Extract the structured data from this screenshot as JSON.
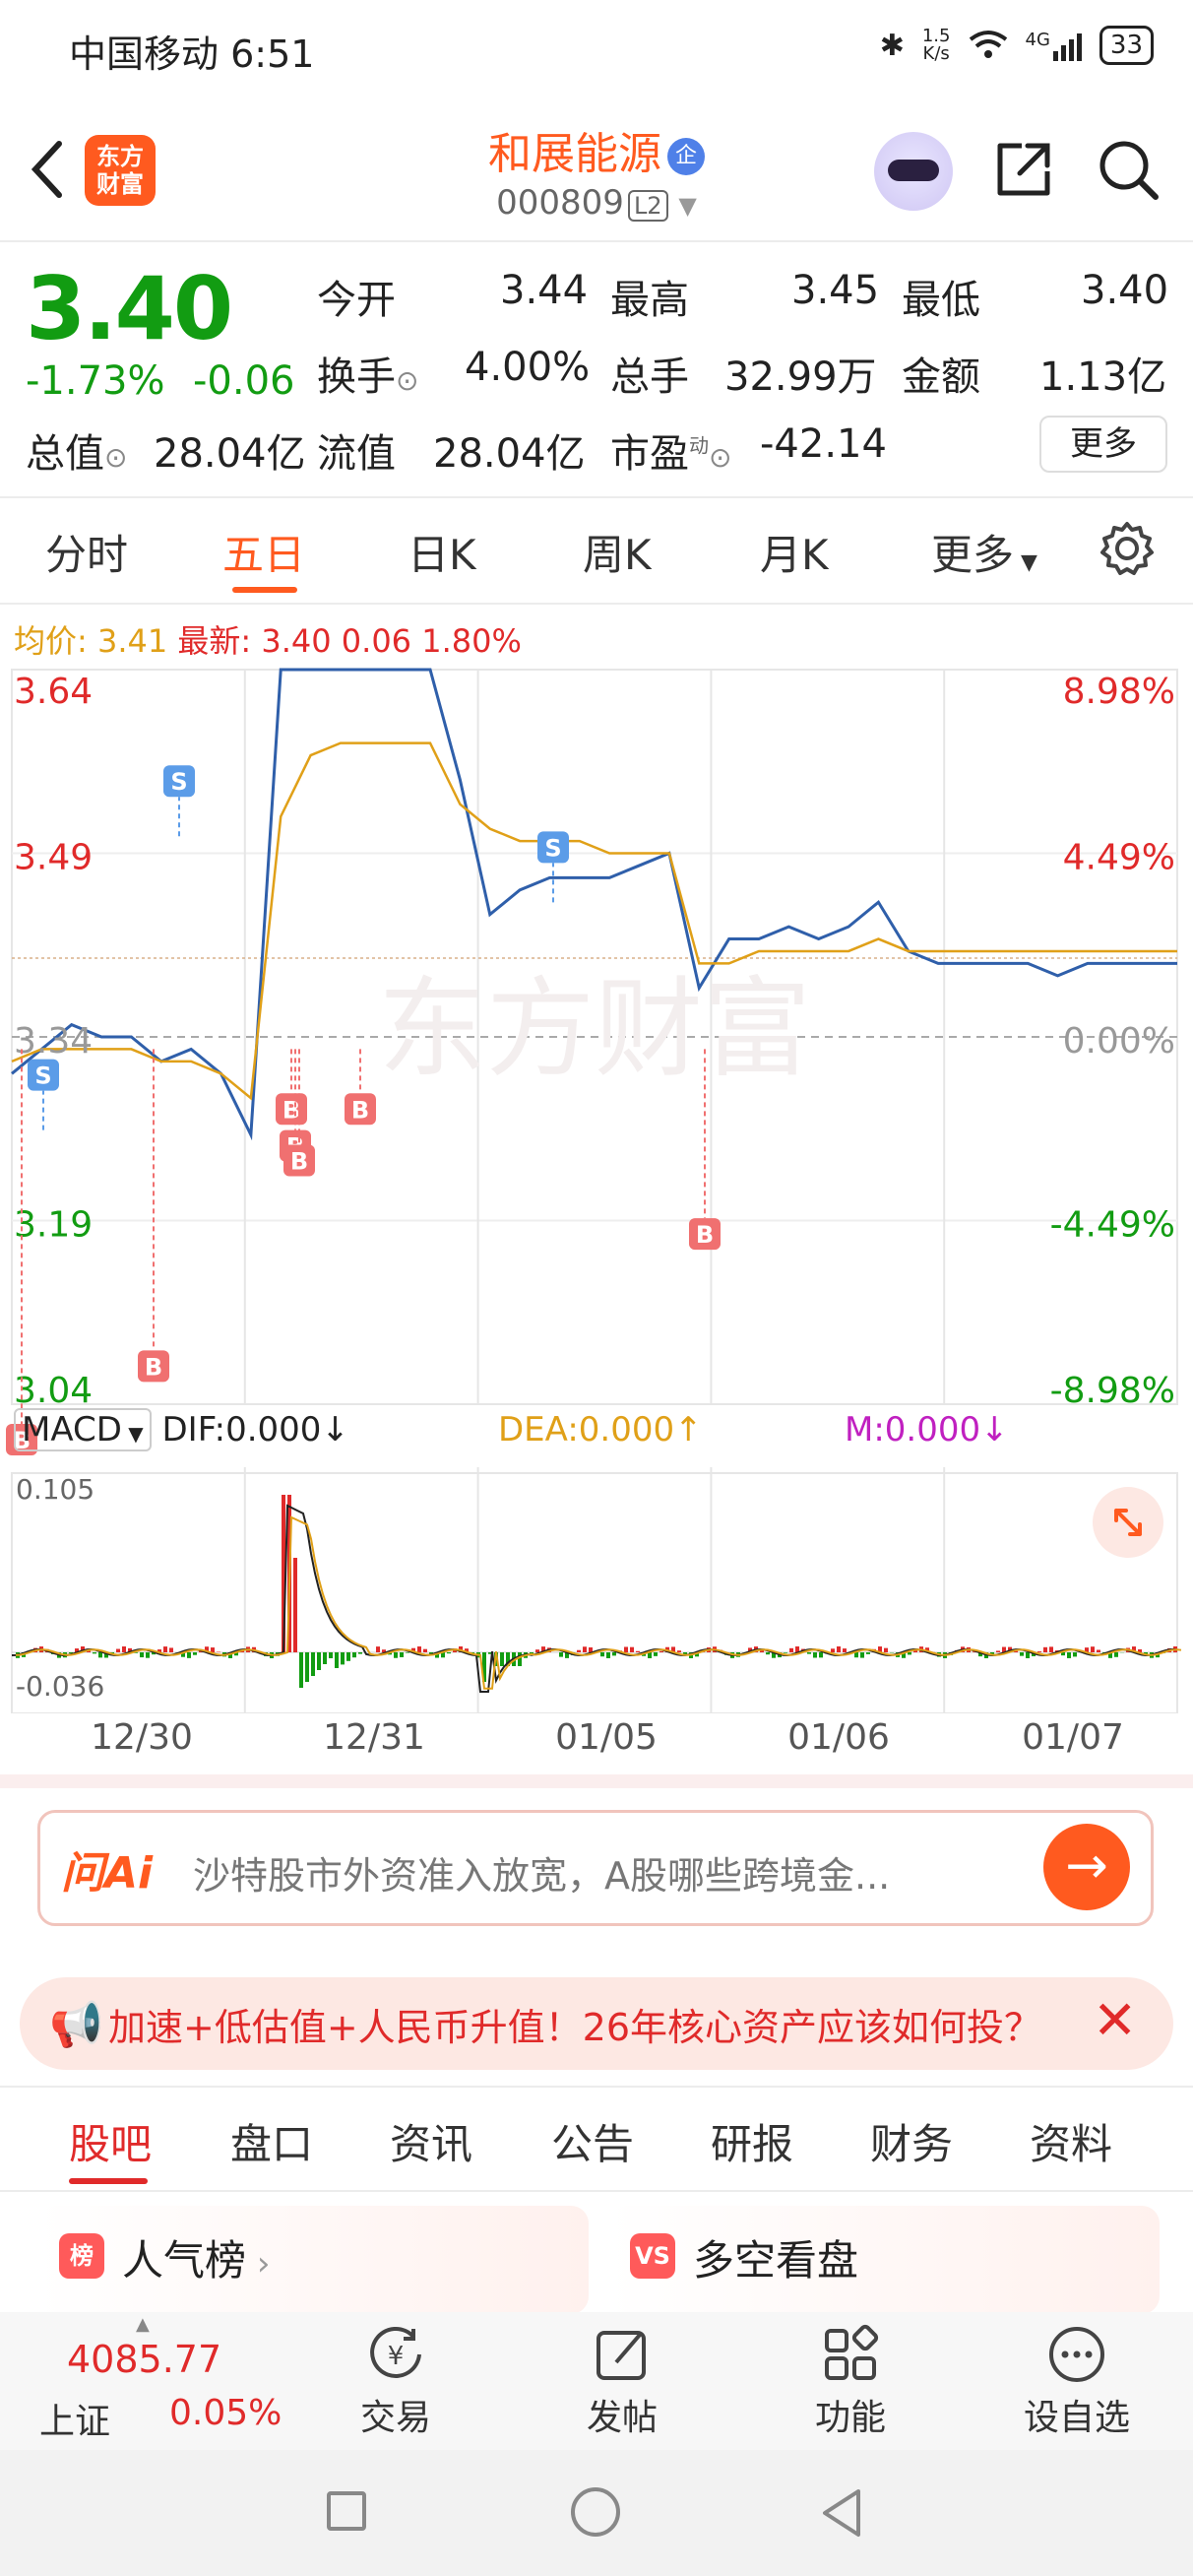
{
  "status_bar": {
    "carrier": "中国移动",
    "time": "6:51",
    "net_speed_top": "1.5",
    "net_speed_bottom": "K/s",
    "signal_label": "4G",
    "battery": "33"
  },
  "header": {
    "logo_text": "东方\n财富",
    "stock_name": "和展能源",
    "badge": "企",
    "stock_code": "000809",
    "level": "L2"
  },
  "quote": {
    "price": "3.40",
    "change_pct": "-1.73%",
    "change": "-0.06",
    "open_label": "今开",
    "open": "3.44",
    "high_label": "最高",
    "high": "3.45",
    "low_label": "最低",
    "low": "3.40",
    "turnover_label": "换手",
    "turnover": "4.00%",
    "volume_label": "总手",
    "volume": "32.99万",
    "amount_label": "金额",
    "amount": "1.13亿",
    "mktcap_label": "总值",
    "mktcap": "28.04亿",
    "float_label": "流值",
    "float_cap": "28.04亿",
    "pe_label": "市盈",
    "pe_sup": "动",
    "pe": "-42.14",
    "more": "更多"
  },
  "tabs": [
    "分时",
    "五日",
    "日K",
    "周K",
    "月K",
    "更多"
  ],
  "active_tab": 1,
  "avg_line": {
    "avg_label": "均价:",
    "avg": "3.41",
    "latest_label": "最新:",
    "latest": "3.40",
    "chg": "0.06",
    "pct": "1.80%"
  },
  "chart_data": {
    "type": "line",
    "y_ticks_left": [
      "3.64",
      "3.49",
      "3.34",
      "3.19",
      "3.04"
    ],
    "y_ticks_right": [
      "8.98%",
      "4.49%",
      "0.00%",
      "-4.49%",
      "-8.98%"
    ],
    "ylim": [
      3.04,
      3.64
    ],
    "ref_price": 3.34,
    "x": [
      "12/30",
      "12/31",
      "01/05",
      "01/06",
      "01/07"
    ],
    "series": [
      {
        "values": [
          3.31,
          3.33,
          3.35,
          3.34,
          3.34,
          3.32,
          3.33,
          3.31,
          3.26,
          3.64,
          3.64,
          3.64,
          3.64,
          3.64,
          3.64,
          3.55,
          3.44,
          3.46,
          3.47,
          3.47,
          3.47,
          3.48,
          3.49,
          3.38,
          3.42,
          3.42,
          3.43,
          3.42,
          3.43,
          3.45,
          3.41,
          3.4,
          3.4,
          3.4,
          3.4,
          3.39,
          3.4,
          3.4,
          3.4,
          3.4
        ]
      },
      {
        "values": [
          3.32,
          3.33,
          3.33,
          3.33,
          3.33,
          3.32,
          3.32,
          3.31,
          3.29,
          3.52,
          3.57,
          3.58,
          3.58,
          3.58,
          3.58,
          3.53,
          3.51,
          3.5,
          3.5,
          3.5,
          3.49,
          3.49,
          3.49,
          3.4,
          3.4,
          3.41,
          3.41,
          3.41,
          3.41,
          3.42,
          3.41,
          3.41,
          3.41,
          3.41,
          3.41,
          3.41,
          3.41,
          3.41,
          3.41,
          3.41
        ]
      }
    ],
    "markers": [
      "B",
      "S",
      "B",
      "S",
      "B",
      "B",
      "B",
      "B",
      "S",
      "B"
    ],
    "watermark": "东方财富"
  },
  "macd": {
    "select": "MACD",
    "dif": "DIF:0.000",
    "dea": "DEA:0.000",
    "m": "M:0.000",
    "ymax": "0.105",
    "ymin": "-0.036"
  },
  "ai": {
    "logo": "问Ai",
    "text": "沙特股市外资准入放宽，A股哪些跨境金..."
  },
  "news": {
    "text": "加速+低估值+人民币升值！26年核心资产应该如何投？"
  },
  "subtabs": [
    "股吧",
    "盘口",
    "资讯",
    "公告",
    "研报",
    "财务",
    "资料"
  ],
  "cards": [
    {
      "title": "人气榜",
      "icon": "榜"
    },
    {
      "title": "多空看盘",
      "icon": "VS"
    }
  ],
  "bottom_nav": {
    "index_value": "4085.77",
    "index_name": "上证",
    "index_pct": "0.05%",
    "items": [
      "交易",
      "发帖",
      "功能",
      "设自选"
    ]
  },
  "colors": {
    "accent": "#ff5a1f",
    "up": "#e02a2a",
    "down": "#129c12",
    "price_line": "#2f5faa",
    "avg_line": "#e0a018"
  }
}
